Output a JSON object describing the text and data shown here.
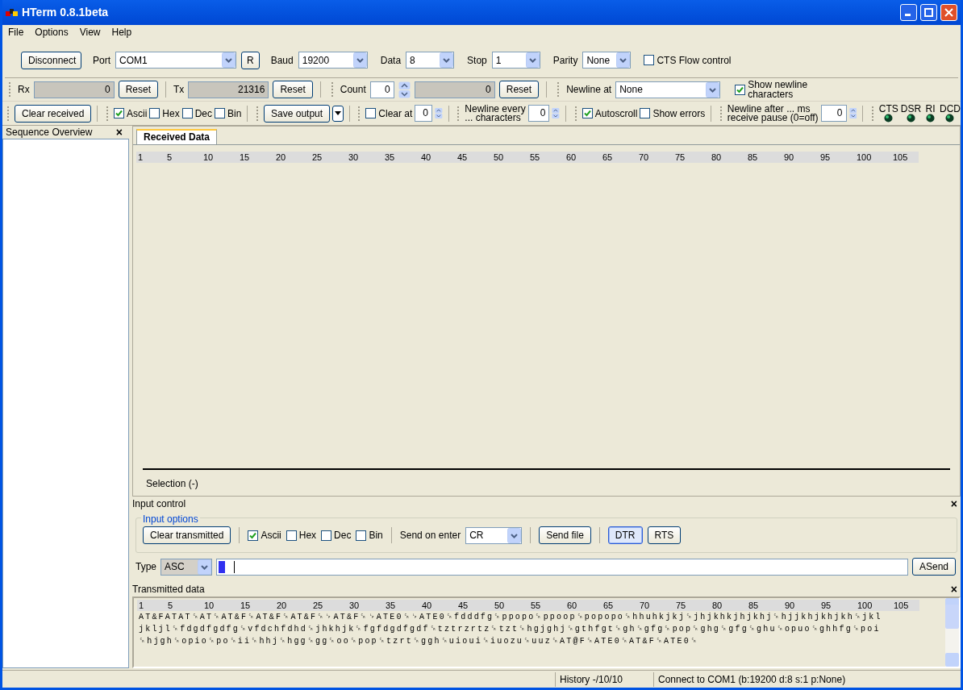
{
  "window": {
    "title": "HTerm 0.8.1beta"
  },
  "menu": [
    {
      "label": "File"
    },
    {
      "label": "Options"
    },
    {
      "label": "View"
    },
    {
      "label": "Help"
    }
  ],
  "connection": {
    "disconnect": "Disconnect",
    "port_label": "Port",
    "port": "COM1",
    "refresh": "R",
    "baud_label": "Baud",
    "baud": "19200",
    "data_label": "Data",
    "data": "8",
    "stop_label": "Stop",
    "stop": "1",
    "parity_label": "Parity",
    "parity": "None",
    "cts_flow": {
      "label": "CTS Flow control",
      "checked": false
    }
  },
  "counters": {
    "rx_label": "Rx",
    "rx": "0",
    "rx_reset": "Reset",
    "tx_label": "Tx",
    "tx": "21316",
    "tx_reset": "Reset",
    "count_label": "Count",
    "count": "0",
    "count_value": "0",
    "count_reset": "Reset",
    "newline_at_label": "Newline at",
    "newline_at": "None",
    "show_newline": {
      "label": "Show newline\ncharacters",
      "checked": true
    }
  },
  "display": {
    "clear_received": "Clear received",
    "formats": [
      {
        "label": "Ascii",
        "checked": true
      },
      {
        "label": "Hex",
        "checked": false
      },
      {
        "label": "Dec",
        "checked": false
      },
      {
        "label": "Bin",
        "checked": false
      }
    ],
    "save_output": "Save output",
    "clear_at": {
      "label": "Clear at",
      "checked": false,
      "value": "0"
    },
    "newline_every": {
      "label": "Newline every\n... characters",
      "value": "0"
    },
    "autoscroll": {
      "label": "Autoscroll",
      "checked": true
    },
    "show_errors": {
      "label": "Show errors",
      "checked": false
    },
    "newline_after": {
      "label": "Newline after ... ms\nreceive pause (0=off)",
      "value": "0"
    },
    "signals": [
      {
        "label": "CTS"
      },
      {
        "label": "DSR"
      },
      {
        "label": "RI"
      },
      {
        "label": "DCD"
      }
    ]
  },
  "sidebar": {
    "title": "Sequence Overview",
    "close": "×"
  },
  "received": {
    "tab": "Received Data",
    "ruler": [
      "1",
      "5",
      "10",
      "15",
      "20",
      "25",
      "30",
      "35",
      "40",
      "45",
      "50",
      "55",
      "60",
      "65",
      "70",
      "75",
      "80",
      "85",
      "90",
      "95",
      "100",
      "105"
    ],
    "selection": "Selection (-)"
  },
  "input_control": {
    "title": "Input control",
    "close": "×",
    "group": "Input options",
    "clear_transmitted": "Clear transmitted",
    "formats": [
      {
        "label": "Ascii",
        "checked": true
      },
      {
        "label": "Hex",
        "checked": false
      },
      {
        "label": "Dec",
        "checked": false
      },
      {
        "label": "Bin",
        "checked": false
      }
    ],
    "send_on_enter_label": "Send on enter",
    "send_on_enter": "CR",
    "send_file": "Send file",
    "dtr": {
      "label": "DTR",
      "selected": true
    },
    "rts": {
      "label": "RTS",
      "selected": false
    },
    "type_label": "Type",
    "type": "ASC",
    "send": "ASend"
  },
  "transmitted": {
    "title": "Transmitted data",
    "close": "×",
    "ruler": [
      "1",
      "5",
      "10",
      "15",
      "20",
      "25",
      "30",
      "35",
      "40",
      "45",
      "50",
      "55",
      "60",
      "65",
      "70",
      "75",
      "80",
      "85",
      "90",
      "95",
      "100",
      "105"
    ],
    "lines": [
      "AT&FATAT␍AT␍AT&F␍AT&F␍AT&F␍␊AT&F␍␊ATE0␍␊ATE0␍fdddfg␍ppopo␍ppoop␍popopo␍hhuhkjkj␍jhjkhkjhjkhj␍hjjkhjkhjkh␍jkl",
      "jkljl␍fdgdfgdfg␍vfdchfdhd␍jhkhjk␍fgfdgdfgdf␍tztrzrtz␍tzt␍hgjghj␍gthfgt␍gh␍gfg␍pop␍ghg␍gfg␍ghu␍opuo␍ghhfg␍poi",
      "␍hjgh␍opio␍po␍ii␍hhj␍hgg␍gg␍oo␍pop␍tzrt␍ggh␍uioui␍iuozu␍uuz␍AT@F␍ATE0␍AT&F␍ATE0␍"
    ]
  },
  "status": {
    "history": "History -/10/10",
    "connection": "Connect to COM1 (b:19200 d:8 s:1 p:None)"
  }
}
